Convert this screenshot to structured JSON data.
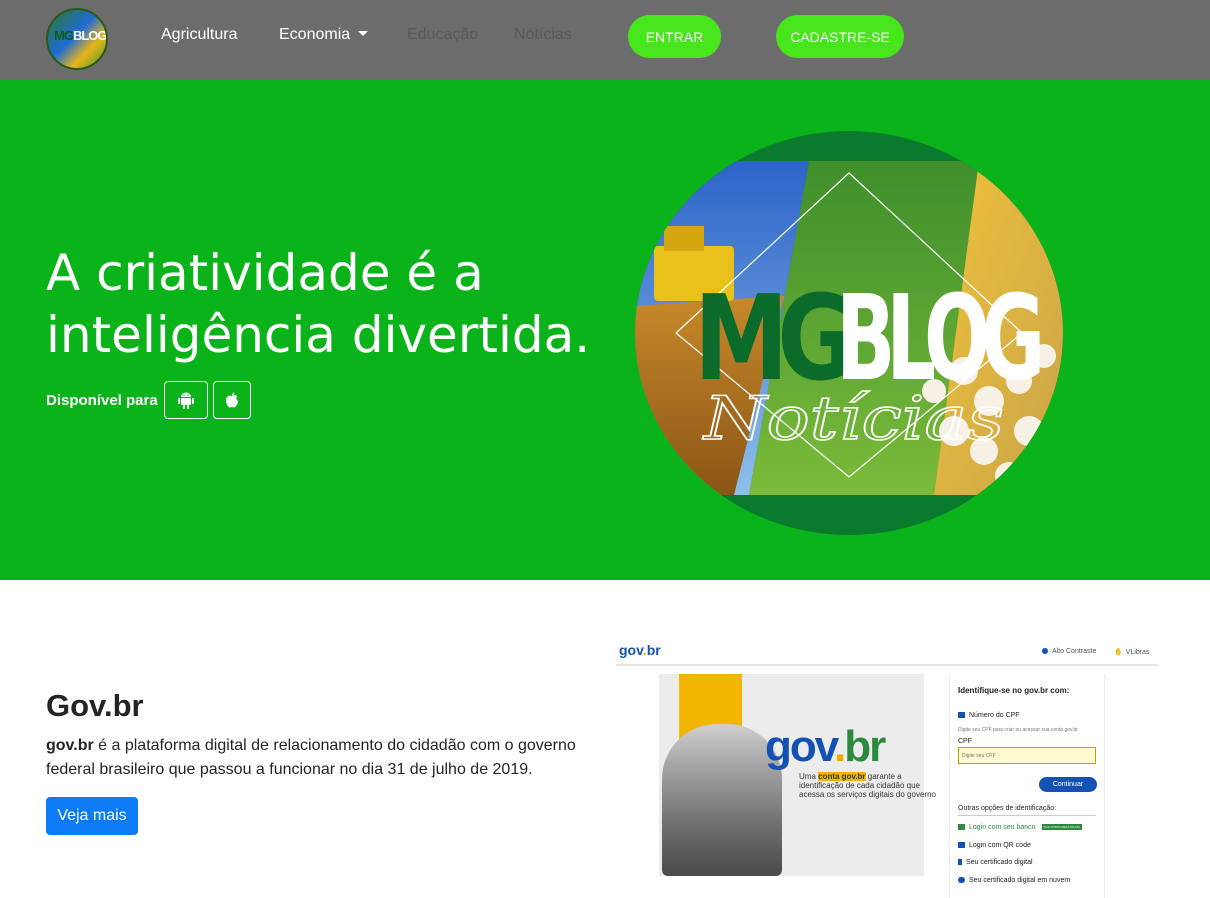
{
  "navbar": {
    "brand": {
      "logo_mg": "MG",
      "logo_blog": "BLOG"
    },
    "items": [
      {
        "label": "Agricultura"
      },
      {
        "label": "Economia"
      },
      {
        "label": "Educação"
      },
      {
        "label": "Notícias"
      }
    ],
    "login_label": "ENTRAR",
    "signup_label": "CADASTRE-SE",
    "colors": {
      "bg": "#6c6c6c",
      "button": "#47e61c"
    }
  },
  "hero": {
    "title": "A criatividade é a inteligência divertida.",
    "available_label": "Disponível para",
    "stores": [
      {
        "icon": "android-icon"
      },
      {
        "icon": "apple-icon"
      }
    ],
    "logo": {
      "mg": "MG",
      "blog": "BLOG",
      "script": "Notícias"
    },
    "colors": {
      "bg": "#0bb31a",
      "circle": "#0a7a2f"
    }
  },
  "section": {
    "title": "Gov.br",
    "text_bold": "gov.br",
    "text_rest": " é a plataforma digital de relacionamento do cidadão com o governo federal brasileiro que passou a funcionar no dia 31 de julho de 2019.",
    "button_label": "Veja mais"
  },
  "govbr_image": {
    "logo": {
      "p1": "gov",
      "p2": ".",
      "p3": "br"
    },
    "header_options": [
      "Alto Contraste",
      "VLibras"
    ],
    "banner_logo": {
      "p1": "gov",
      "p2": ".",
      "p3": "br"
    },
    "banner_caption_parts": [
      "Uma ",
      "conta gov.br",
      " garante a identificação de cada cidadão que acessa os serviços digitais do governo"
    ],
    "panel": {
      "title": "Identifique-se no gov.br com:",
      "cpf_option": "Número do CPF",
      "hint": "Digite seu CPF para criar ou acessar sua conta gov.br",
      "cpf_label": "CPF",
      "cpf_placeholder": "Digite seu CPF",
      "continue_label": "Continuar",
      "other_title": "Outras opções de identificação:",
      "other_options": [
        "Login com seu banco",
        "Login com QR code",
        "Seu certificado digital",
        "Seu certificado digital em nuvem"
      ],
      "bank_badge": "SUA CONTA SERÁ PRATA"
    }
  }
}
